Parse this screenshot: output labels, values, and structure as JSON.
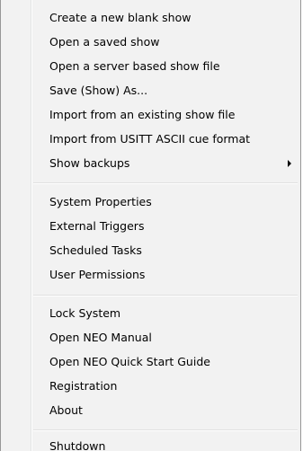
{
  "menu": {
    "groups": [
      {
        "items": [
          {
            "label": "Create a new blank show"
          },
          {
            "label": "Open a saved show"
          },
          {
            "label": "Open a server based show file"
          },
          {
            "label": "Save (Show) As..."
          },
          {
            "label": "Import from an existing show file"
          },
          {
            "label": "Import from USITT ASCII cue format"
          },
          {
            "label": "Show backups",
            "has_submenu": true
          }
        ]
      },
      {
        "items": [
          {
            "label": "System Properties"
          },
          {
            "label": "External Triggers"
          },
          {
            "label": "Scheduled Tasks"
          },
          {
            "label": "User Permissions"
          }
        ]
      },
      {
        "items": [
          {
            "label": "Lock System"
          },
          {
            "label": "Open NEO Manual"
          },
          {
            "label": "Open NEO Quick Start Guide"
          },
          {
            "label": "Registration"
          },
          {
            "label": "About"
          }
        ]
      },
      {
        "items": [
          {
            "label": "Shutdown"
          }
        ]
      }
    ],
    "submenu_arrow_icon": "chevron-right-icon"
  }
}
